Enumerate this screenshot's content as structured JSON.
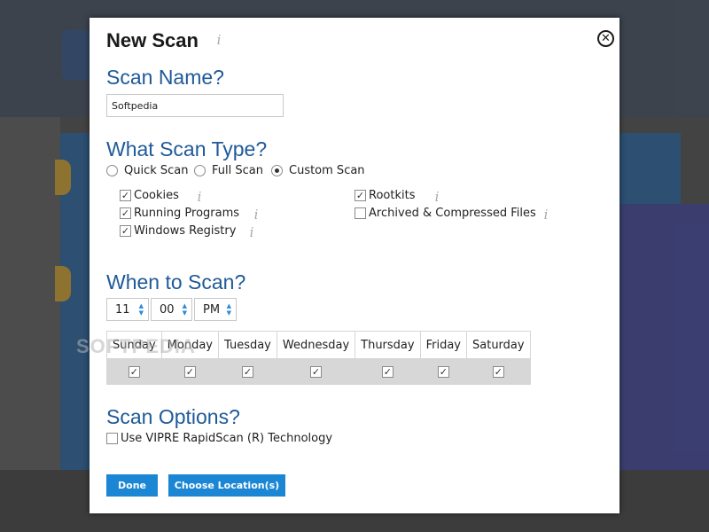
{
  "dialog": {
    "title": "New Scan",
    "close_glyph": "✕"
  },
  "info_glyph": "i",
  "scan_name": {
    "heading": "Scan Name?",
    "value": "Softpedia"
  },
  "scan_type": {
    "heading": "What Scan Type?",
    "options": [
      {
        "label": "Quick Scan",
        "selected": false
      },
      {
        "label": "Full Scan",
        "selected": false
      },
      {
        "label": "Custom Scan",
        "selected": true
      }
    ],
    "custom_items": [
      {
        "label": "Cookies",
        "checked": true
      },
      {
        "label": "Running Programs",
        "checked": true
      },
      {
        "label": "Windows Registry",
        "checked": true
      },
      {
        "label": "Rootkits",
        "checked": true
      },
      {
        "label": "Archived & Compressed Files",
        "checked": false
      }
    ]
  },
  "when": {
    "heading": "When to Scan?",
    "hour": "11",
    "minute": "00",
    "ampm": "PM",
    "days": [
      {
        "label": "Sunday",
        "checked": true
      },
      {
        "label": "Monday",
        "checked": true
      },
      {
        "label": "Tuesday",
        "checked": true
      },
      {
        "label": "Wednesday",
        "checked": true
      },
      {
        "label": "Thursday",
        "checked": true
      },
      {
        "label": "Friday",
        "checked": true
      },
      {
        "label": "Saturday",
        "checked": true
      }
    ]
  },
  "options": {
    "heading": "Scan Options?",
    "rapidscan": {
      "label": "Use VIPRE RapidScan (R) Technology",
      "checked": false
    }
  },
  "buttons": {
    "done": "Done",
    "choose_location": "Choose Location(s)"
  },
  "watermark": "SOFTPEDIA",
  "check_glyph": "✓",
  "colors": {
    "heading_blue": "#1f5a99",
    "button_blue": "#1b86d3",
    "spinner_arrow": "#2b8ad8"
  }
}
